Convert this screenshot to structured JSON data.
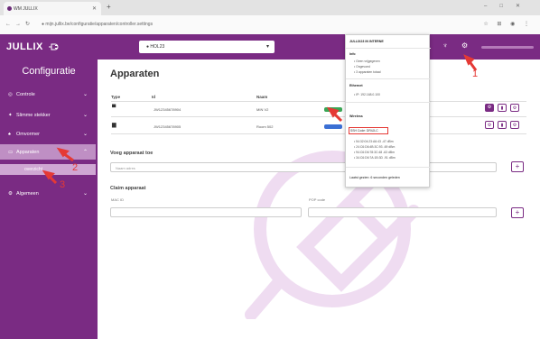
{
  "browser": {
    "tab_title": "WM JULLIX",
    "url": "● mijn.jullix.be/configuratie/apparaten/controller.settings"
  },
  "app": {
    "logo": "JULLIX",
    "installation": "● HOL23",
    "user_name": "",
    "colors": {
      "brand": "#7a2b83"
    }
  },
  "sidebar": {
    "title": "Configuratie",
    "items": [
      {
        "label": "Controle",
        "icon": "controller-icon"
      },
      {
        "label": "Slimme stekker",
        "icon": "plug-icon"
      },
      {
        "label": "Omvormer",
        "icon": "inverter-icon"
      },
      {
        "label": "Apparaten",
        "icon": "devices-icon"
      },
      {
        "label": "Algemeen",
        "icon": "gear-icon"
      }
    ],
    "subitem": "overzicht"
  },
  "main": {
    "title": "Apparaten",
    "table": {
      "headers": [
        "Type",
        "Id",
        "Naam"
      ],
      "rows": [
        {
          "id": "JW12345678904",
          "name": "MIN V2"
        },
        {
          "id": "JW12345678905",
          "name": "Room 502"
        }
      ]
    },
    "add_section": {
      "title": "Voeg apparaat toe",
      "placeholder": "Naam adres"
    },
    "claim_section": {
      "title": "Claim apparaat",
      "mac_label": "MAC ID",
      "pop_label": "POP code"
    }
  },
  "dropdown": {
    "header": "JULLIX23 IN INTERNE",
    "groups": [
      {
        "title": "Info",
        "lines": [
          "• Geen vrijgegeven",
          "• Ongevoed",
          "• 3 apparaten totaal"
        ]
      },
      {
        "title": "Ethernet",
        "lines": [
          "• IP: 192.168.0.100"
        ]
      },
      {
        "title": "Wireless",
        "lines": [
          "• 54:32:04:23:A6:43 -47 dBm",
          "• 24:C6:D6:4B:3C:93 -69 dBm",
          "• 94:C6:D6:78:3C:48 -63 dBm",
          "• 34:C6:D6:7A:1B:3D -91 dBm"
        ]
      }
    ],
    "highlight": "SSH Code: DR4JLC",
    "footer": "Laatst gezien: 6 seconden geleden"
  },
  "annotations": [
    "1",
    "2",
    "3"
  ]
}
